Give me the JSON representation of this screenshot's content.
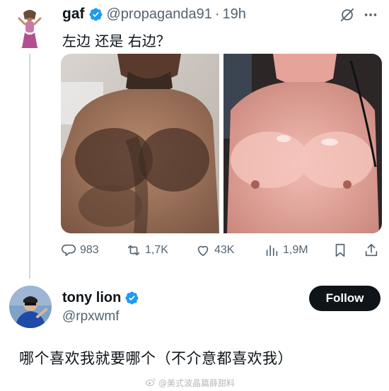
{
  "tweet1": {
    "author_name": "gaf",
    "author_handle": "@propaganda91",
    "separator": "·",
    "time": "19h",
    "text": "左边 还是 右边？",
    "media": [
      {
        "description_icon": "photo-hairy-chest"
      },
      {
        "description_icon": "photo-oiled-chest"
      }
    ],
    "actions": {
      "replies": "983",
      "reposts": "1,7K",
      "likes": "43K",
      "views": "1,9M"
    }
  },
  "tweet2": {
    "author_name": "tony lion",
    "author_handle": "@rpxwmf",
    "follow_label": "Follow",
    "text": "哪个喜欢我就要哪个（不介意都喜欢我）"
  },
  "watermark": {
    "text": "@美式波晶篇薛甜料"
  },
  "colors": {
    "verified_blue": "#1d9bf0",
    "secondary_text": "#536471",
    "follow_bg": "#0f1419"
  }
}
